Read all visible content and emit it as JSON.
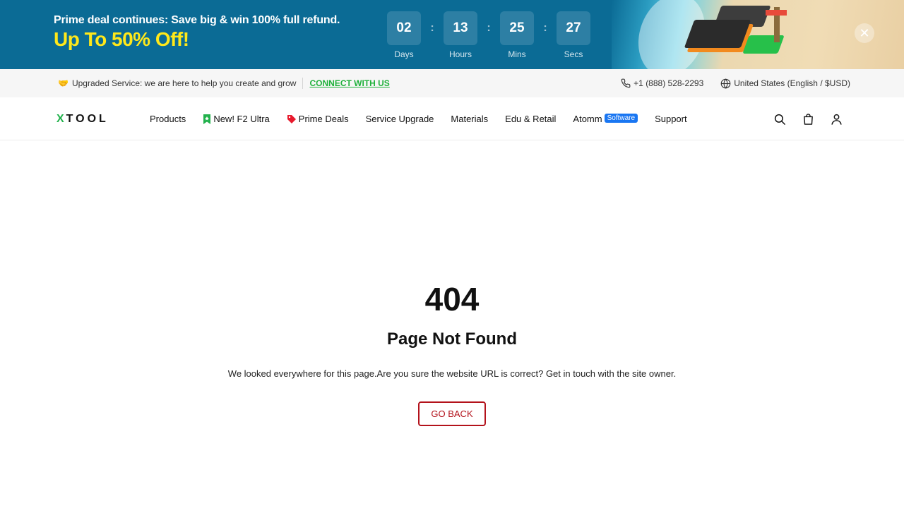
{
  "promo": {
    "line1": "Prime deal continues: Save big & win 100% full refund.",
    "line2": "Up To 50% Off!",
    "countdown": [
      {
        "value": "02",
        "label": "Days"
      },
      {
        "value": "13",
        "label": "Hours"
      },
      {
        "value": "25",
        "label": "Mins"
      },
      {
        "value": "27",
        "label": "Secs"
      }
    ],
    "separator": ":",
    "close_glyph": "✕"
  },
  "infobar": {
    "hand_glyph": "🤝",
    "service_text": "Upgraded Service: we are here to help you create and grow",
    "connect_label": "CONNECT WITH US",
    "phone": "+1 (888) 528-2293",
    "region": "United States (English / $USD)"
  },
  "nav": {
    "logo_x": "X",
    "logo_rest": "TOOL",
    "links": {
      "products": "Products",
      "f2_ultra": "New! F2 Ultra",
      "prime_deals": "Prime Deals",
      "service_upgrade": "Service Upgrade",
      "materials": "Materials",
      "edu_retail": "Edu & Retail",
      "atomm": "Atomm",
      "atomm_badge": "Software",
      "support": "Support"
    },
    "icons": [
      "search-icon",
      "bag-icon",
      "user-icon"
    ]
  },
  "error": {
    "code": "404",
    "title": "Page Not Found",
    "description": "We looked everywhere for this page.Are you sure the website URL is correct? Get in touch with the site owner.",
    "button": "GO BACK"
  },
  "colors": {
    "banner_bg": "#0b6b95",
    "promo_yellow": "#ffe81a",
    "brand_green": "#22b14c",
    "link_green": "#1fb13b",
    "badge_blue": "#1976f2",
    "button_red": "#b3121b"
  }
}
